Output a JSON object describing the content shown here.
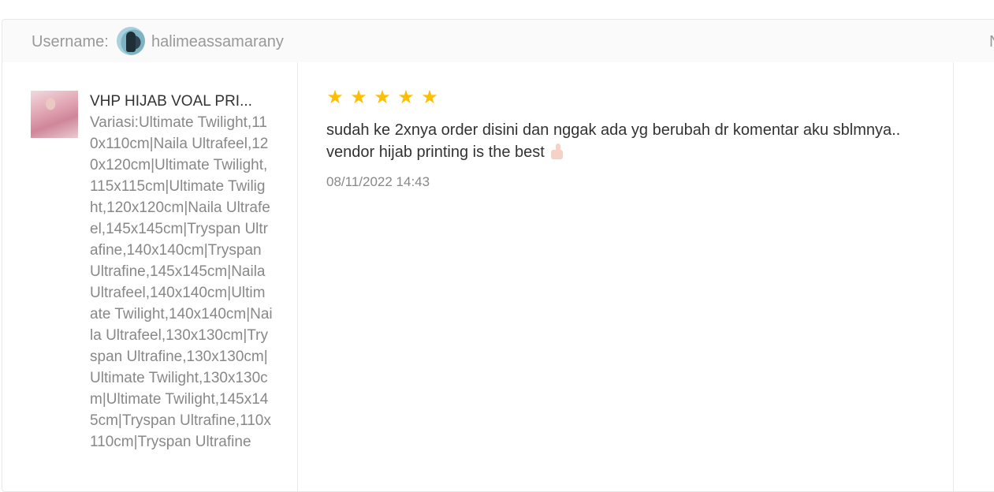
{
  "header": {
    "username_label": "Username:",
    "username": "halimeassamarany",
    "right_text": "N"
  },
  "product": {
    "name": "VHP HIJAB VOAL PRI...",
    "variation": "Variasi:Ultimate Twilight,110x110cm|Naila Ultrafeel,120x120cm|Ultimate Twilight,115x115cm|Ultimate Twilight,120x120cm|Naila Ultrafeel,145x145cm|Tryspan Ultrafine,140x140cm|Tryspan Ultrafine,145x145cm|Naila Ultrafeel,140x140cm|Ultimate Twilight,140x140cm|Naila Ultrafeel,130x130cm|Tryspan Ultrafine,130x130cm|Ultimate Twilight,130x130cm|Ultimate Twilight,145x145cm|Tryspan Ultrafine,110x110cm|Tryspan Ultrafine"
  },
  "review": {
    "rating": 5,
    "star_glyph": "★",
    "star_color": "#ffbf00",
    "text": "sudah ke 2xnya order disini dan nggak ada yg berubah dr komentar aku sblmnya.. vendor hijab printing is the best",
    "emoji_icon": "thumbs-up-icon",
    "date": "08/11/2022 14:43"
  }
}
